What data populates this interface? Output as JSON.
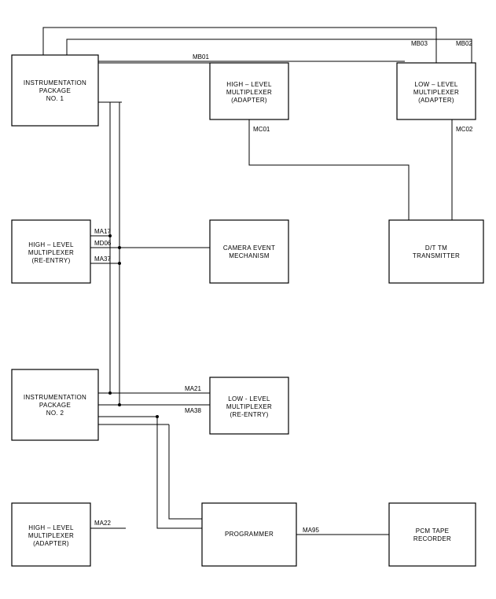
{
  "nodes": {
    "inst1": {
      "label": [
        "INSTRUMENTATION",
        "PACKAGE",
        "NO. 1"
      ]
    },
    "hl_adapt1": {
      "label": [
        "HIGH – LEVEL",
        "MULTIPLEXER",
        "(ADAPTER)"
      ]
    },
    "ll_adapt": {
      "label": [
        "LOW – LEVEL",
        "MULTIPLEXER",
        "(ADAPTER)"
      ]
    },
    "hl_re": {
      "label": [
        "HIGH – LEVEL",
        "MULTIPLEXER",
        "(RE-ENTRY)"
      ]
    },
    "camera": {
      "label": [
        "CAMERA EVENT",
        "MECHANISM"
      ]
    },
    "dttm": {
      "label": [
        "D/T TM",
        "TRANSMITTER"
      ]
    },
    "inst2": {
      "label": [
        "INSTRUMENTATION",
        "PACKAGE",
        "NO. 2"
      ]
    },
    "ll_re": {
      "label": [
        "LOW - LEVEL",
        "MULTIPLEXER",
        "(RE-ENTRY)"
      ]
    },
    "hl_adapt2": {
      "label": [
        "HIGH – LEVEL",
        "MULTIPLEXER",
        "(ADAPTER)"
      ]
    },
    "prog": {
      "label": [
        "PROGRAMMER"
      ]
    },
    "pcm": {
      "label": [
        "PCM TAPE",
        "RECORDER"
      ]
    }
  },
  "edges": {
    "mb01": "MB01",
    "mb02": "MB02",
    "mb03": "MB03",
    "mc01": "MC01",
    "mc02": "MC02",
    "ma17": "MA17",
    "md06": "MD06",
    "ma37": "MA37",
    "ma21": "MA21",
    "ma38": "MA38",
    "ma22": "MA22",
    "ma95": "MA95"
  }
}
